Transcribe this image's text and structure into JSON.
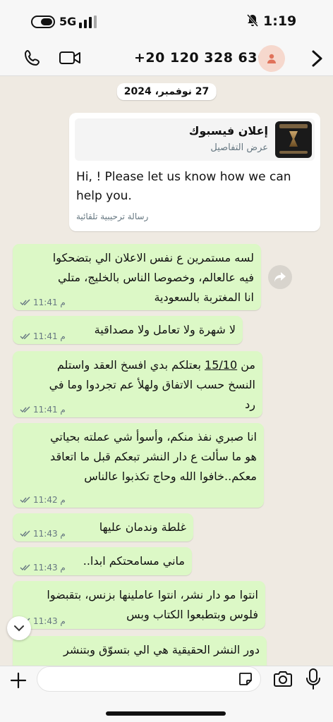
{
  "status_bar": {
    "network": "5G",
    "time": "1:19"
  },
  "header": {
    "contact_number": "+20 120 328 6362"
  },
  "chat": {
    "date": "27 نوفمبر، 2024",
    "ad_card": {
      "title": "إعلان فيسبوك",
      "subtitle": "عرض التفاصيل",
      "body": "Hi, ! Please let us know how we can help you.",
      "footer": "رسالة ترحيبية تلقائية"
    },
    "messages": [
      {
        "lines": [
          "لسه مستمرين ع نفس الاعلان الي بتضحكوا",
          "فيه عالعالم، وخصوصا الناس بالخليج، متلي",
          "انا المغتربة بالسعودية"
        ],
        "time": "11:41 م"
      },
      {
        "lines": [
          "لا شهرة ولا تعامل ولا مصداقية"
        ],
        "time": "11:41 م"
      },
      {
        "lines_pre": "من ",
        "underlined": "15/10",
        "lines_post": " بعتلكم بدي افسخ العقد واستلم",
        "lines": [
          "النسخ حسب الاتفاق ولهلأ عم تجردوا وما في",
          "رد"
        ],
        "time": "11:41 م"
      },
      {
        "lines": [
          "انا صبري نفذ منكم، وأسوأ شي عملته بحياتي",
          "هو ما سألت ع دار النشر تبعكم قبل ما اتعاقد",
          "معكم..خافوا الله وحاج تكذبوا عالناس"
        ],
        "time": "11:42 م"
      },
      {
        "lines": [
          "غلطة وندمان عليها"
        ],
        "time": "11:43 م"
      },
      {
        "lines": [
          "ماني مسامحتكم ابدا.."
        ],
        "time": "11:43 م"
      },
      {
        "lines": [
          "انتوا مو دار نشر، انتوا عاملينها بزنس، بتقبضوا",
          "فلوس وبتطبعوا الكتاب وبس"
        ],
        "time": "11:43 م"
      },
      {
        "lines": [
          "دور النشر الحقيقية هي الي بتسوّق وبتنشر"
        ],
        "time": ""
      }
    ]
  },
  "input": {
    "placeholder": ""
  },
  "colors": {
    "outgoing_bubble": "#dcf8c6",
    "chat_bg": "#efeae2"
  }
}
